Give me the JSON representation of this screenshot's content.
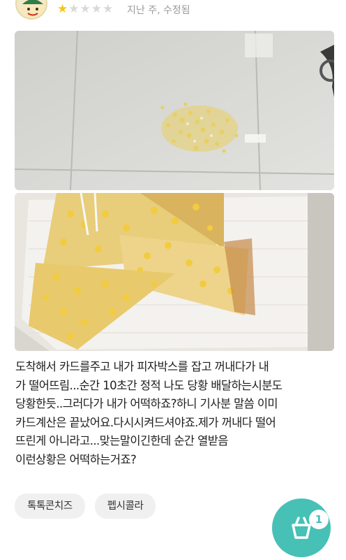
{
  "review": {
    "rating": 1,
    "max_rating": 5,
    "meta": "지난 주, 수정됨",
    "text_lines": [
      "도착해서 카드를주고 내가 피자박스를 잡고 꺼내다가 내",
      "가 떨어뜨림...순간 10초간 정적 나도 당황 배달하는시분도",
      "당황한듯..그러다가 내가 어떡하죠?하니 기사분 말씀 이미",
      "카드계산은 끝났어요.다시시켜드셔야죠.제가 꺼내다 떨어",
      "뜨린게 아니라고...맞는말이긴한데 순간 열받음",
      "이런상황은 어떡하는거죠?"
    ]
  },
  "photos": {
    "first": "corn-spilled-on-floor",
    "second": "pizza-slices-on-box-lid"
  },
  "tags": [
    "톡톡콘치즈",
    "펩시콜라"
  ],
  "cart": {
    "count": "1",
    "icon": "cart-icon"
  },
  "colors": {
    "star": "#f5c518",
    "accent": "#47c0b6",
    "tag_bg": "#f0f0f0"
  }
}
